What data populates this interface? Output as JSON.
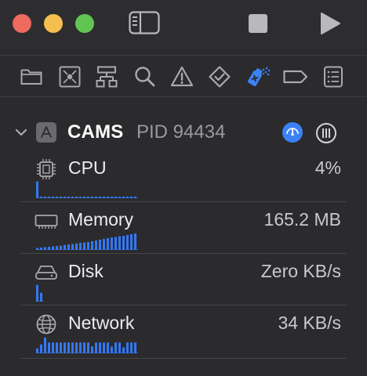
{
  "colors": {
    "close": "#ec6a5e",
    "minimize": "#f4bf4f",
    "zoom": "#61c554",
    "accent": "#3b82f6",
    "graph_bar": "#3478f6"
  },
  "toolbar": {
    "navigator_toggle_icon": "sidebar-left-icon",
    "stop_icon": "stop-icon",
    "run_icon": "play-icon"
  },
  "navigator_tabs": [
    {
      "icon": "folder-icon",
      "selected": false
    },
    {
      "icon": "source-control-icon",
      "selected": false
    },
    {
      "icon": "symbol-hierarchy-icon",
      "selected": false
    },
    {
      "icon": "search-icon",
      "selected": false
    },
    {
      "icon": "warning-icon",
      "selected": false
    },
    {
      "icon": "test-diamond-icon",
      "selected": false
    },
    {
      "icon": "debug-spray-icon",
      "selected": true
    },
    {
      "icon": "breakpoint-tag-icon",
      "selected": false
    },
    {
      "icon": "report-list-icon",
      "selected": false
    }
  ],
  "process": {
    "name": "CAMS",
    "pid_label": "PID 94434",
    "expanded": true
  },
  "metrics": [
    {
      "key": "cpu",
      "label": "CPU",
      "value": "4%",
      "bars": [
        0.85,
        0.08,
        0.08,
        0.08,
        0.08,
        0.08,
        0.08,
        0.08,
        0.08,
        0.08,
        0.08,
        0.08,
        0.08,
        0.08,
        0.08,
        0.08,
        0.08,
        0.08,
        0.08,
        0.08,
        0.08,
        0.08,
        0.08,
        0.08,
        0.08,
        0.08
      ]
    },
    {
      "key": "memory",
      "label": "Memory",
      "value": "165.2 MB",
      "bars": [
        0.1,
        0.12,
        0.14,
        0.16,
        0.18,
        0.2,
        0.22,
        0.25,
        0.28,
        0.3,
        0.33,
        0.36,
        0.38,
        0.4,
        0.44,
        0.48,
        0.52,
        0.56,
        0.6,
        0.64,
        0.66,
        0.7,
        0.72,
        0.76,
        0.8,
        0.84
      ]
    },
    {
      "key": "disk",
      "label": "Disk",
      "value": "Zero KB/s",
      "bars": [
        0.85,
        0.45
      ]
    },
    {
      "key": "network",
      "label": "Network",
      "value": "34 KB/s",
      "bars": [
        0.25,
        0.45,
        0.8,
        0.55,
        0.55,
        0.55,
        0.55,
        0.55,
        0.55,
        0.55,
        0.55,
        0.55,
        0.55,
        0.55,
        0.35,
        0.55,
        0.55,
        0.55,
        0.55,
        0.35,
        0.55,
        0.55,
        0.3,
        0.55,
        0.55,
        0.55
      ]
    }
  ]
}
